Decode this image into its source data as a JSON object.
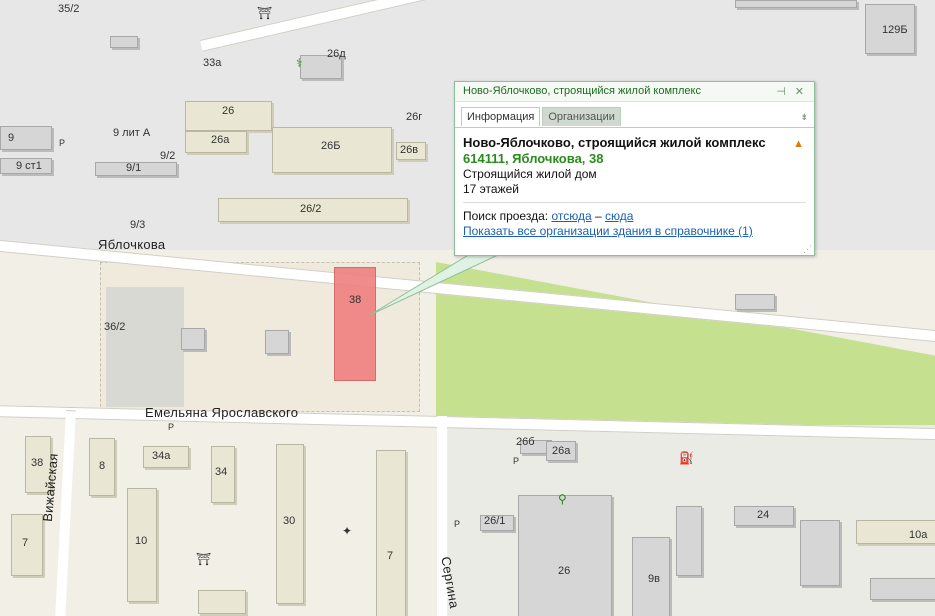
{
  "popup": {
    "header_title": "Ново-Яблочково, строящийся жилой комплекс",
    "pin_icon": "pin-icon",
    "close_icon": "close-icon",
    "tabs": [
      {
        "label": "Информация",
        "active": true
      },
      {
        "label": "Организации",
        "active": false
      }
    ],
    "title": "Ново-Яблочково, строящийся жилой комплекс",
    "address": "614111, Яблочкова, 38",
    "description": "Строящийся жилой дом",
    "floors": "17 этажей",
    "route_label": "Поиск проезда:",
    "route_from": "отсюда",
    "route_dash": "–",
    "route_to": "сюда",
    "show_orgs_link": "Показать все организации здания в справочнике (1)",
    "accent_color": "#2b8a1e",
    "link_color": "#1a5fb4"
  },
  "map": {
    "streets": {
      "yablochkova": "Яблочкова",
      "emelyana": "Емельяна Ярославского",
      "vizhayskaya": "Вижайская",
      "sergina": "Сергина"
    },
    "labels": {
      "b35_2": "35/2",
      "b33a": "33а",
      "b26d": "26д",
      "b129b": "129Б",
      "b26": "26",
      "b26g": "26г",
      "b9": "9",
      "b9litA": "9 лит А",
      "b26a": "26а",
      "b26B": "26Б",
      "b26v": "26в",
      "b9_2": "9/2",
      "b9st1": "9 ст1",
      "b9_1": "9/1",
      "b26_2": "26/2",
      "b9_3": "9/3",
      "b38": "38",
      "b36_2": "36/2",
      "b38w": "38",
      "b8": "8",
      "b34a": "34а",
      "b34": "34",
      "b30": "30",
      "b7": "7",
      "b26b_s": "26б",
      "b26a_s": "26а",
      "b26_1": "26/1",
      "b26_s": "26",
      "b24": "24",
      "b10a": "10а",
      "b10": "10",
      "b7w": "7",
      "b9v": "9в",
      "p1": "P",
      "p2": "P",
      "p3": "P",
      "p4": "P"
    },
    "selected_building_color": "#f08080",
    "park_color": "#c5e08f"
  }
}
